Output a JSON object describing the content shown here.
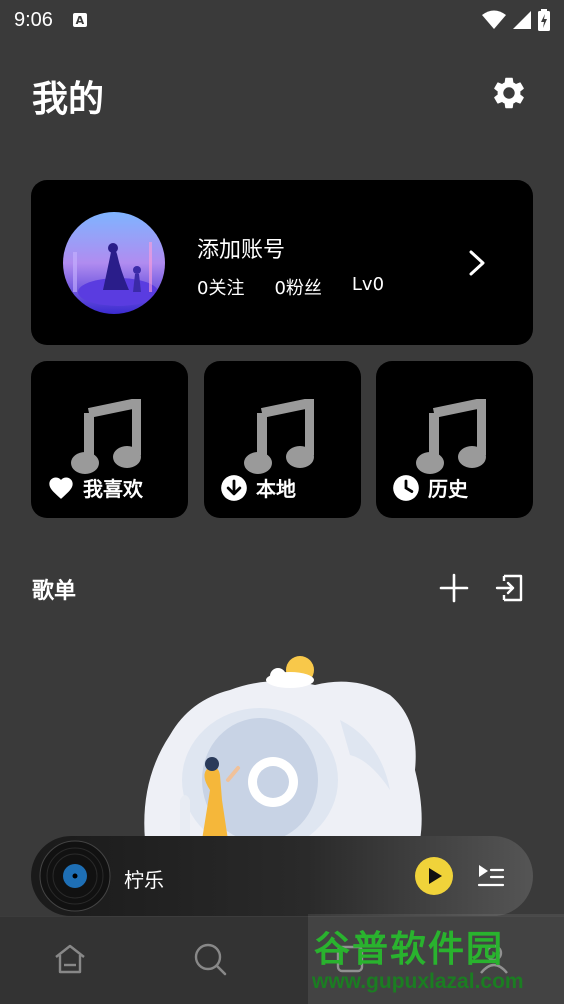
{
  "status_bar": {
    "time": "9:06",
    "notification_letter": "A"
  },
  "page": {
    "title": "我的"
  },
  "account": {
    "name": "添加账号",
    "follows": "0关注",
    "fans": "0粉丝",
    "level": "Lv0"
  },
  "quick_links": [
    {
      "label": "我喜欢",
      "icon": "heart-icon"
    },
    {
      "label": "本地",
      "icon": "download-icon"
    },
    {
      "label": "历史",
      "icon": "clock-icon"
    }
  ],
  "playlist_section": {
    "title": "歌单"
  },
  "player": {
    "track_title": "柠乐"
  },
  "bottom_nav": [
    "home-icon",
    "search-icon",
    "music-icon",
    "profile-icon"
  ],
  "watermark": {
    "name": "谷普软件园",
    "url": "www.gupuxlazal.com"
  },
  "colors": {
    "background": "#3a3a3a",
    "card": "#000000",
    "play_accent": "#f0d33a"
  }
}
